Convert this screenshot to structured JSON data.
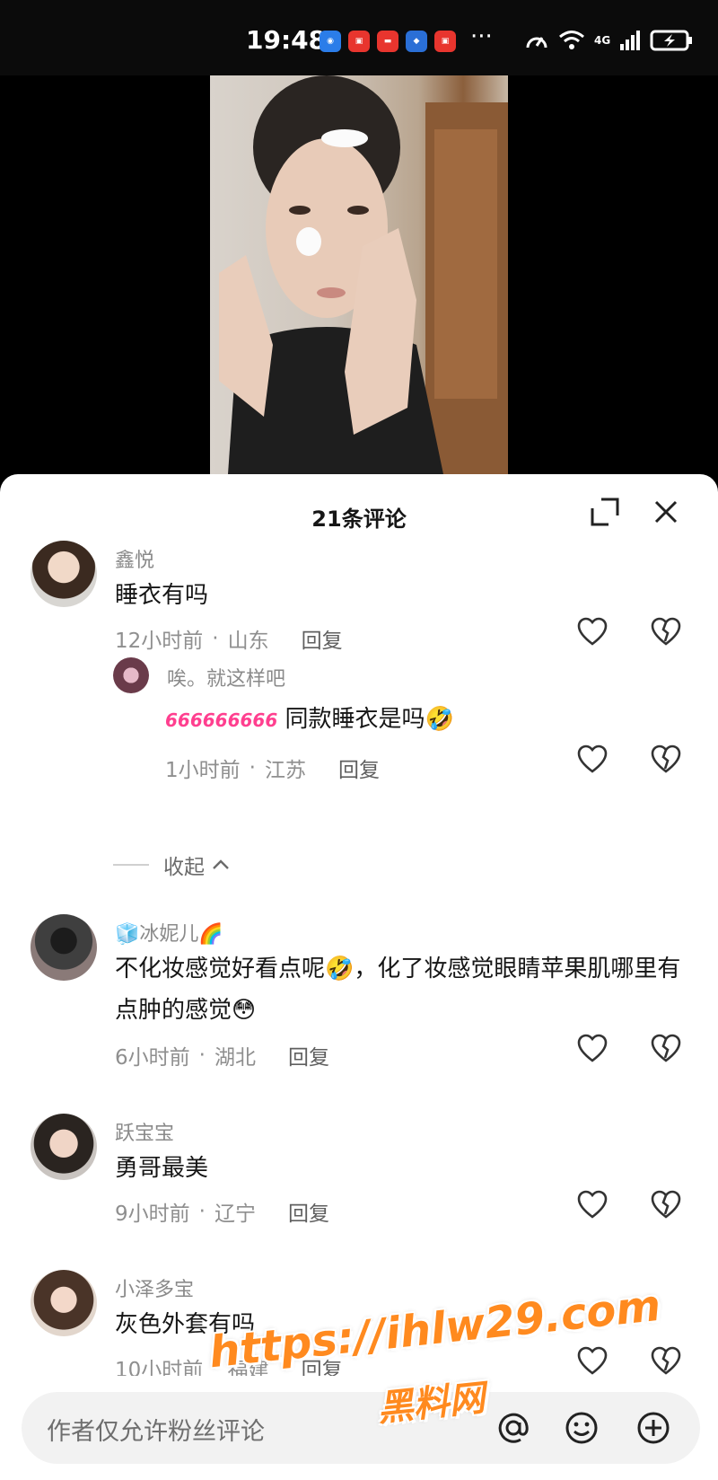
{
  "status_bar": {
    "time": "19:48",
    "more": "···",
    "network": "4G"
  },
  "panel": {
    "title": "21条评论"
  },
  "comments": [
    {
      "username": "鑫悦",
      "text": "睡衣有吗",
      "time": "12小时前",
      "location": "山东",
      "reply_label": "回复"
    },
    {
      "username": "唉。就这样吧",
      "text_prefix": "666666666",
      "text": "同款睡衣是吗🤣",
      "time": "1小时前",
      "location": "江苏",
      "reply_label": "回复"
    },
    {
      "username": "🧊冰妮儿🌈",
      "text": "不化妆感觉好看点呢🤣，化了妆感觉眼睛苹果肌哪里有点肿的感觉😳",
      "time": "6小时前",
      "location": "湖北",
      "reply_label": "回复"
    },
    {
      "username": "跃宝宝",
      "text": "勇哥最美",
      "time": "9小时前",
      "location": "辽宁",
      "reply_label": "回复"
    },
    {
      "username": "小泽多宝",
      "text": "灰色外套有吗",
      "time": "10小时前",
      "location": "福建",
      "reply_label": "回复"
    }
  ],
  "collapse_label": "收起",
  "input": {
    "placeholder": "作者仅允许粉丝评论"
  },
  "watermark": {
    "url": "https://ihlw29.com",
    "name": "黑料网"
  }
}
